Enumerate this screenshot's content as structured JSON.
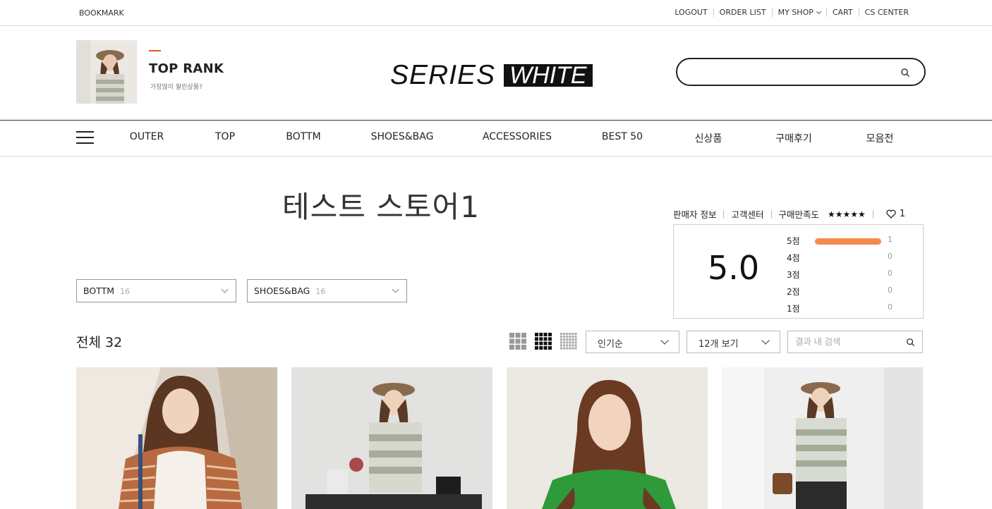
{
  "topbar": {
    "bookmark": "BOOKMARK",
    "links": [
      "LOGOUT",
      "ORDER LIST",
      "MY SHOP",
      "CART",
      "CS CENTER"
    ]
  },
  "header": {
    "rank_title": "TOP RANK",
    "rank_subtitle": "가장많이 팔린상품?",
    "logo_left": "SERIES",
    "logo_right": "WHITE",
    "search_placeholder": ""
  },
  "nav": {
    "items": [
      "OUTER",
      "TOP",
      "BOTTM",
      "SHOES&BAG",
      "ACCESSORIES",
      "BEST 50",
      "신상품",
      "구매후기",
      "모음전"
    ]
  },
  "store": {
    "title": "테스트 스토어1",
    "seller_info": "판매자 정보",
    "customer_center": "고객센터",
    "satisfaction_label": "구매만족도",
    "stars": "★★★★★",
    "likes": "1"
  },
  "rating": {
    "score": "5.0",
    "rows": [
      {
        "label": "5점",
        "count": "1",
        "fraction": 1.0
      },
      {
        "label": "4점",
        "count": "0",
        "fraction": 0
      },
      {
        "label": "3점",
        "count": "0",
        "fraction": 0
      },
      {
        "label": "2점",
        "count": "0",
        "fraction": 0
      },
      {
        "label": "1점",
        "count": "0",
        "fraction": 0
      }
    ]
  },
  "filters": [
    {
      "name": "BOTTM",
      "count": "16"
    },
    {
      "name": "SHOES&BAG",
      "count": "16"
    }
  ],
  "listing": {
    "total": "전체 32",
    "sort_value": "인기순",
    "per_page_value": "12개 보기",
    "result_search_placeholder": "결과 내 검색"
  },
  "colors": {
    "accent": "#e2541e",
    "rating_bar": "#f48a4c"
  }
}
